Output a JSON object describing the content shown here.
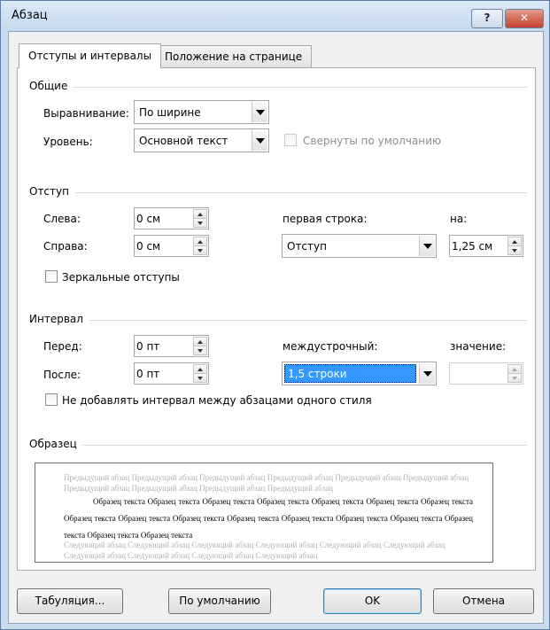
{
  "window": {
    "title": "Абзац",
    "help_label": "?",
    "close_label": "✕"
  },
  "tabs": [
    {
      "label": "Отступы и интервалы",
      "active": true
    },
    {
      "label": "Положение на странице",
      "active": false
    }
  ],
  "general": {
    "title": "Общие",
    "alignment_label": "Выравнивание:",
    "alignment_value": "По ширине",
    "level_label": "Уровень:",
    "level_value": "Основной текст",
    "collapsed_label": "Свернуты по умолчанию"
  },
  "indent": {
    "title": "Отступ",
    "left_label": "Слева:",
    "left_value": "0 см",
    "right_label": "Справа:",
    "right_value": "0 см",
    "first_line_label": "первая строка:",
    "first_line_value": "Отступ",
    "by_label": "на:",
    "by_value": "1,25 см",
    "mirror_label": "Зеркальные отступы"
  },
  "spacing": {
    "title": "Интервал",
    "before_label": "Перед:",
    "before_value": "0 пт",
    "after_label": "После:",
    "after_value": "0 пт",
    "line_spacing_label": "междустрочный:",
    "line_spacing_value": "1,5 строки",
    "at_label": "значение:",
    "at_value": "",
    "dont_add_label": "Не добавлять интервал между абзацами одного стиля"
  },
  "preview": {
    "title": "Образец",
    "previous": "Предыдущий абзац Предыдущий абзац Предыдущий абзац Предыдущий абзац Предыдущий абзац Предыдущий абзац Предыдущий абзац Предыдущий абзац Предыдущий абзац Предыдущий абзац",
    "sample": "Образец текста Образец текста Образец текста Образец текста Образец текста Образец текста Образец текста Образец текста Образец текста Образец текста Образец текста Образец текста Образец текста Образец текста Образец текста Образец текста Образец текста",
    "next": "Следующий абзац Следующий абзац Следующий абзац Следующий абзац Следующий абзац Следующий абзац Следующий абзац Следующий абзац Следующий абзац Следующий абзац"
  },
  "buttons": {
    "tabs": "Табуляция...",
    "default": "По умолчанию",
    "ok": "OK",
    "cancel": "Отмена"
  }
}
